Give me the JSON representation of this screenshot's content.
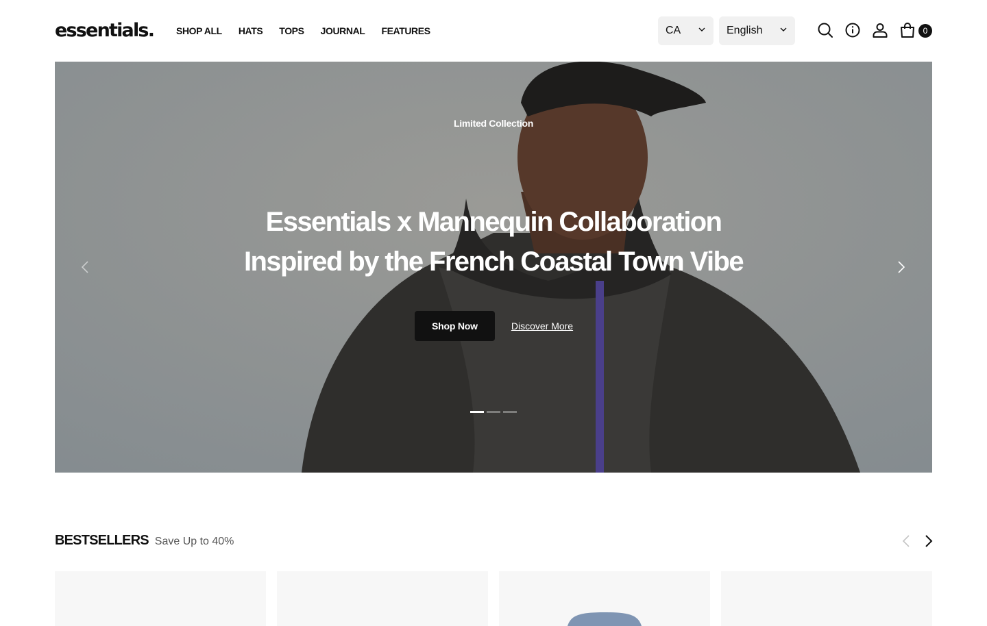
{
  "brand": {
    "logo": "essentials."
  },
  "nav": {
    "items": [
      {
        "label": "SHOP ALL"
      },
      {
        "label": "HATS"
      },
      {
        "label": "TOPS"
      },
      {
        "label": "JOURNAL"
      },
      {
        "label": "FEATURES"
      }
    ]
  },
  "selectors": {
    "country": "CA",
    "language": "English"
  },
  "header_icons": [
    "search-icon",
    "info-icon",
    "account-icon",
    "cart-icon"
  ],
  "cart": {
    "count": "0"
  },
  "hero": {
    "eyebrow": "Limited Collection",
    "title_line1": "Essentials x Mannequin Collaboration",
    "title_line2": "Inspired by the French Coastal Town Vibe",
    "primary_cta": "Shop Now",
    "secondary_cta": "Discover More",
    "slide_count": 3,
    "active_slide": 1
  },
  "bestsellers": {
    "title": "BESTSELLERS",
    "subtitle": "Save Up to 40%"
  },
  "colors": {
    "accent": "#111111",
    "hero_bg": "#8f9496",
    "card_bg": "#f7f7f7"
  }
}
